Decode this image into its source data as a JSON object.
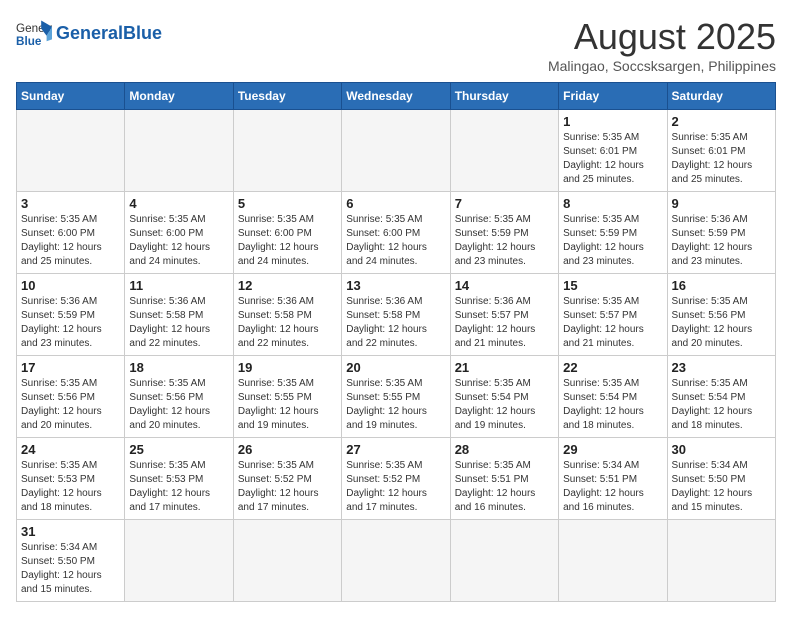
{
  "header": {
    "logo_general": "General",
    "logo_blue": "Blue",
    "month_title": "August 2025",
    "location": "Malingao, Soccsksargen, Philippines"
  },
  "days_of_week": [
    "Sunday",
    "Monday",
    "Tuesday",
    "Wednesday",
    "Thursday",
    "Friday",
    "Saturday"
  ],
  "weeks": [
    [
      {
        "day": "",
        "info": ""
      },
      {
        "day": "",
        "info": ""
      },
      {
        "day": "",
        "info": ""
      },
      {
        "day": "",
        "info": ""
      },
      {
        "day": "",
        "info": ""
      },
      {
        "day": "1",
        "info": "Sunrise: 5:35 AM\nSunset: 6:01 PM\nDaylight: 12 hours and 25 minutes."
      },
      {
        "day": "2",
        "info": "Sunrise: 5:35 AM\nSunset: 6:01 PM\nDaylight: 12 hours and 25 minutes."
      }
    ],
    [
      {
        "day": "3",
        "info": "Sunrise: 5:35 AM\nSunset: 6:00 PM\nDaylight: 12 hours and 25 minutes."
      },
      {
        "day": "4",
        "info": "Sunrise: 5:35 AM\nSunset: 6:00 PM\nDaylight: 12 hours and 24 minutes."
      },
      {
        "day": "5",
        "info": "Sunrise: 5:35 AM\nSunset: 6:00 PM\nDaylight: 12 hours and 24 minutes."
      },
      {
        "day": "6",
        "info": "Sunrise: 5:35 AM\nSunset: 6:00 PM\nDaylight: 12 hours and 24 minutes."
      },
      {
        "day": "7",
        "info": "Sunrise: 5:35 AM\nSunset: 5:59 PM\nDaylight: 12 hours and 23 minutes."
      },
      {
        "day": "8",
        "info": "Sunrise: 5:35 AM\nSunset: 5:59 PM\nDaylight: 12 hours and 23 minutes."
      },
      {
        "day": "9",
        "info": "Sunrise: 5:36 AM\nSunset: 5:59 PM\nDaylight: 12 hours and 23 minutes."
      }
    ],
    [
      {
        "day": "10",
        "info": "Sunrise: 5:36 AM\nSunset: 5:59 PM\nDaylight: 12 hours and 23 minutes."
      },
      {
        "day": "11",
        "info": "Sunrise: 5:36 AM\nSunset: 5:58 PM\nDaylight: 12 hours and 22 minutes."
      },
      {
        "day": "12",
        "info": "Sunrise: 5:36 AM\nSunset: 5:58 PM\nDaylight: 12 hours and 22 minutes."
      },
      {
        "day": "13",
        "info": "Sunrise: 5:36 AM\nSunset: 5:58 PM\nDaylight: 12 hours and 22 minutes."
      },
      {
        "day": "14",
        "info": "Sunrise: 5:36 AM\nSunset: 5:57 PM\nDaylight: 12 hours and 21 minutes."
      },
      {
        "day": "15",
        "info": "Sunrise: 5:35 AM\nSunset: 5:57 PM\nDaylight: 12 hours and 21 minutes."
      },
      {
        "day": "16",
        "info": "Sunrise: 5:35 AM\nSunset: 5:56 PM\nDaylight: 12 hours and 20 minutes."
      }
    ],
    [
      {
        "day": "17",
        "info": "Sunrise: 5:35 AM\nSunset: 5:56 PM\nDaylight: 12 hours and 20 minutes."
      },
      {
        "day": "18",
        "info": "Sunrise: 5:35 AM\nSunset: 5:56 PM\nDaylight: 12 hours and 20 minutes."
      },
      {
        "day": "19",
        "info": "Sunrise: 5:35 AM\nSunset: 5:55 PM\nDaylight: 12 hours and 19 minutes."
      },
      {
        "day": "20",
        "info": "Sunrise: 5:35 AM\nSunset: 5:55 PM\nDaylight: 12 hours and 19 minutes."
      },
      {
        "day": "21",
        "info": "Sunrise: 5:35 AM\nSunset: 5:54 PM\nDaylight: 12 hours and 19 minutes."
      },
      {
        "day": "22",
        "info": "Sunrise: 5:35 AM\nSunset: 5:54 PM\nDaylight: 12 hours and 18 minutes."
      },
      {
        "day": "23",
        "info": "Sunrise: 5:35 AM\nSunset: 5:54 PM\nDaylight: 12 hours and 18 minutes."
      }
    ],
    [
      {
        "day": "24",
        "info": "Sunrise: 5:35 AM\nSunset: 5:53 PM\nDaylight: 12 hours and 18 minutes."
      },
      {
        "day": "25",
        "info": "Sunrise: 5:35 AM\nSunset: 5:53 PM\nDaylight: 12 hours and 17 minutes."
      },
      {
        "day": "26",
        "info": "Sunrise: 5:35 AM\nSunset: 5:52 PM\nDaylight: 12 hours and 17 minutes."
      },
      {
        "day": "27",
        "info": "Sunrise: 5:35 AM\nSunset: 5:52 PM\nDaylight: 12 hours and 17 minutes."
      },
      {
        "day": "28",
        "info": "Sunrise: 5:35 AM\nSunset: 5:51 PM\nDaylight: 12 hours and 16 minutes."
      },
      {
        "day": "29",
        "info": "Sunrise: 5:34 AM\nSunset: 5:51 PM\nDaylight: 12 hours and 16 minutes."
      },
      {
        "day": "30",
        "info": "Sunrise: 5:34 AM\nSunset: 5:50 PM\nDaylight: 12 hours and 15 minutes."
      }
    ],
    [
      {
        "day": "31",
        "info": "Sunrise: 5:34 AM\nSunset: 5:50 PM\nDaylight: 12 hours and 15 minutes."
      },
      {
        "day": "",
        "info": ""
      },
      {
        "day": "",
        "info": ""
      },
      {
        "day": "",
        "info": ""
      },
      {
        "day": "",
        "info": ""
      },
      {
        "day": "",
        "info": ""
      },
      {
        "day": "",
        "info": ""
      }
    ]
  ]
}
